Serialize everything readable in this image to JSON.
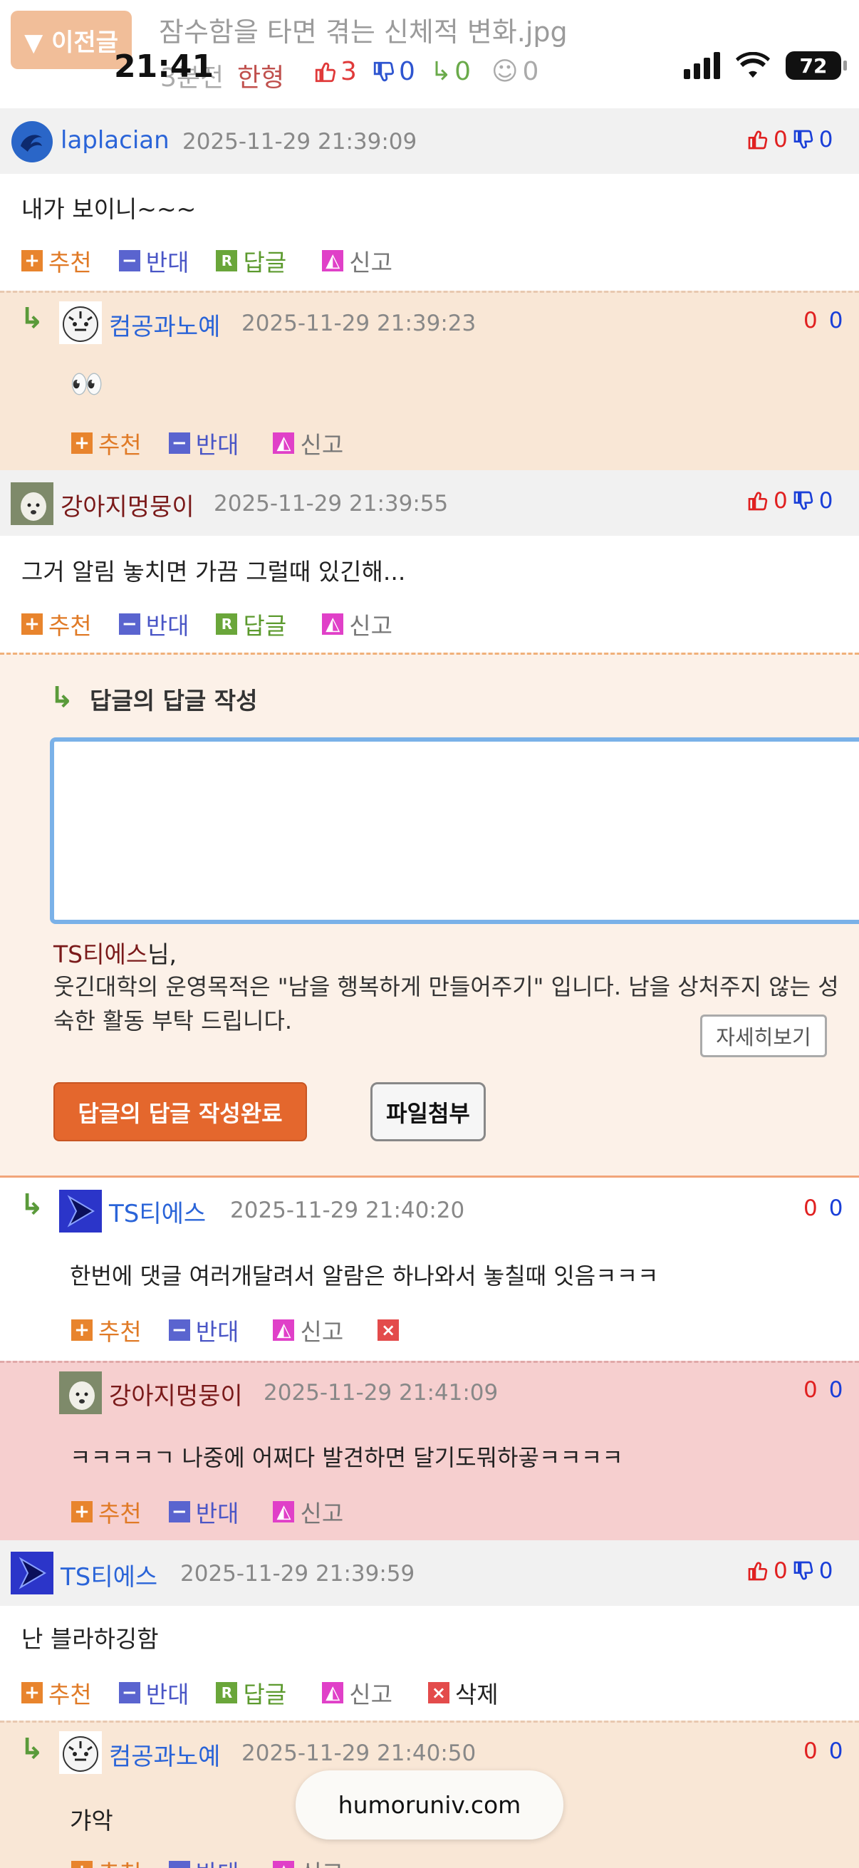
{
  "header": {
    "prev_label": "▼ 이전글",
    "post_title": "잠수함을 타면 겪는 신체적 변화.jpg",
    "post_meta_prefix": "3분전",
    "author": "한형",
    "likes": "3",
    "dislikes": "0",
    "replies": "0",
    "views": "0"
  },
  "status_bar": {
    "time": "21:41",
    "battery": "72"
  },
  "actions": {
    "recommend": "추천",
    "oppose": "반대",
    "reply": "답글",
    "report": "신고",
    "delete": "삭제"
  },
  "comments": [
    {
      "nick": "laplacian",
      "date": "2025-11-29 21:39:09",
      "up": "0",
      "down": "0",
      "text": "내가 보이니~~~"
    },
    {
      "nick": "컴공과노예",
      "date": "2025-11-29 21:39:23",
      "up": "0",
      "down": "0",
      "text": "👀"
    },
    {
      "nick": "강아지멍뭉이",
      "date": "2025-11-29 21:39:55",
      "up": "0",
      "down": "0",
      "text": "그거 알림 놓치면 가끔 그럴때 있긴해..."
    },
    {
      "nick": "TS티에스",
      "date": "2025-11-29 21:40:20",
      "up": "0",
      "down": "0",
      "text": "한번에 댓글 여러개달려서 알람은 하나와서 놓칠때 잇음ㅋㅋㅋ"
    },
    {
      "nick": "강아지멍뭉이",
      "date": "2025-11-29 21:41:09",
      "up": "0",
      "down": "0",
      "text": "ㅋㅋㅋㅋㄱ 나중에 어쩌다 발견하면 달기도뭐하곻ㅋㅋㅋㅋ"
    },
    {
      "nick": "TS티에스",
      "date": "2025-11-29 21:39:59",
      "up": "0",
      "down": "0",
      "text": "난 블라하깅함"
    },
    {
      "nick": "컴공과노예",
      "date": "2025-11-29 21:40:50",
      "up": "0",
      "down": "0",
      "text": "갸악"
    }
  ],
  "reply_form": {
    "title": "답글의 답글 작성",
    "user_name": "TS티에스",
    "user_suffix": "님,",
    "notice": "웃긴대학의 운영목적은 \"남을 행복하게 만들어주기\" 입니다. 남을 상처주지 않는 성숙한 활동 부탁 드립니다.",
    "more": "자세히보기",
    "submit": "답글의 답글 작성완료",
    "attach": "파일첨부"
  },
  "domain": "humoruniv.com",
  "colors": {
    "accent": "#e4672d",
    "reply_bg": "#f9e7d6",
    "highlight_bg": "#f6cfcf",
    "nick_blue": "#2a64d8",
    "nick_dark": "#7a1a1a"
  }
}
